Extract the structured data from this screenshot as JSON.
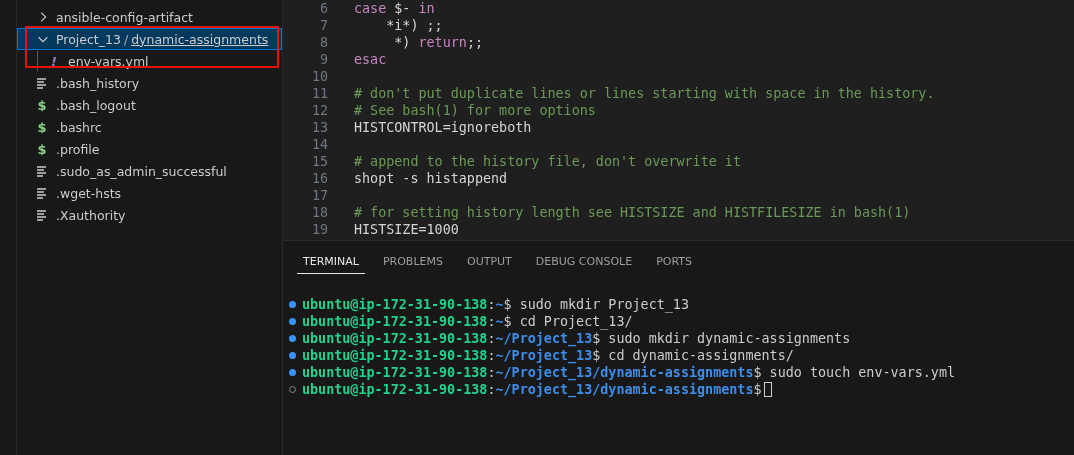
{
  "explorer": {
    "items": [
      {
        "kind": "folder",
        "label": "ansible-config-artifact",
        "expanded": false,
        "selected": false
      },
      {
        "kind": "folder",
        "label": "Project_13",
        "separator": "/",
        "sublabel": "dynamic-assignments",
        "expanded": true,
        "selected": true,
        "children": [
          {
            "kind": "yaml",
            "icon": "!",
            "label": "env-vars.yml",
            "selected": false
          }
        ]
      },
      {
        "kind": "text",
        "label": ".bash_history",
        "selected": false
      },
      {
        "kind": "shell",
        "icon": "$",
        "label": ".bash_logout",
        "selected": false
      },
      {
        "kind": "shell",
        "icon": "$",
        "label": ".bashrc",
        "selected": false
      },
      {
        "kind": "shell",
        "icon": "$",
        "label": ".profile",
        "selected": false
      },
      {
        "kind": "text",
        "label": ".sudo_as_admin_successful",
        "selected": false
      },
      {
        "kind": "text",
        "label": ".wget-hsts",
        "selected": false
      },
      {
        "kind": "text",
        "label": ".Xauthority",
        "selected": false
      }
    ]
  },
  "editor": {
    "lines": [
      {
        "number": "6",
        "tokens": [
          {
            "kind": "keyword",
            "text": "case"
          },
          {
            "kind": "plain",
            "text": " $- "
          },
          {
            "kind": "keyword",
            "text": "in"
          }
        ]
      },
      {
        "number": "7",
        "tokens": [
          {
            "kind": "plain",
            "text": "    *i*) ;;"
          }
        ]
      },
      {
        "number": "8",
        "tokens": [
          {
            "kind": "plain",
            "text": "     *) "
          },
          {
            "kind": "keyword",
            "text": "return"
          },
          {
            "kind": "plain",
            "text": ";;"
          }
        ]
      },
      {
        "number": "9",
        "tokens": [
          {
            "kind": "keyword",
            "text": "esac"
          }
        ]
      },
      {
        "number": "10"
      },
      {
        "number": "11",
        "tokens": [
          {
            "kind": "comment",
            "text": "# don't put duplicate lines or lines starting with space in the history."
          }
        ]
      },
      {
        "number": "12",
        "tokens": [
          {
            "kind": "comment",
            "text": "# See bash(1) for more options"
          }
        ]
      },
      {
        "number": "13",
        "tokens": [
          {
            "kind": "plain",
            "text": "HISTCONTROL=ignoreboth"
          }
        ]
      },
      {
        "number": "14"
      },
      {
        "number": "15",
        "tokens": [
          {
            "kind": "comment",
            "text": "# append to the history file, don't overwrite it"
          }
        ]
      },
      {
        "number": "16",
        "tokens": [
          {
            "kind": "plain",
            "text": "shopt -s histappend"
          }
        ]
      },
      {
        "number": "17"
      },
      {
        "number": "18",
        "tokens": [
          {
            "kind": "comment",
            "text": "# for setting history length see HISTSIZE and HISTFILESIZE in bash(1)"
          }
        ]
      },
      {
        "number": "19",
        "tokens": [
          {
            "kind": "plain",
            "text": "HISTSIZE=1000"
          }
        ]
      }
    ]
  },
  "panel": {
    "tabs": [
      {
        "label": "TERMINAL",
        "selected": true
      },
      {
        "label": "PROBLEMS",
        "selected": false
      },
      {
        "label": "OUTPUT",
        "selected": false
      },
      {
        "label": "DEBUG CONSOLE",
        "selected": false
      },
      {
        "label": "PORTS",
        "selected": false
      }
    ],
    "terminal": [
      {
        "kind": "done",
        "user": "ubuntu@ip-172-31-90-138",
        "separator": ":",
        "path": "~",
        "command": "$ sudo mkdir Project_13"
      },
      {
        "kind": "done",
        "user": "ubuntu@ip-172-31-90-138",
        "separator": ":",
        "path": "~",
        "command": "$ cd Project_13/"
      },
      {
        "kind": "done",
        "user": "ubuntu@ip-172-31-90-138",
        "separator": ":",
        "path": "~/Project_13",
        "command": "$ sudo mkdir dynamic-assignments"
      },
      {
        "kind": "done",
        "user": "ubuntu@ip-172-31-90-138",
        "separator": ":",
        "path": "~/Project_13",
        "command": "$ cd dynamic-assignments/"
      },
      {
        "kind": "done",
        "user": "ubuntu@ip-172-31-90-138",
        "separator": ":",
        "path": "~/Project_13/dynamic-assignments",
        "command": "$ sudo touch env-vars.yml"
      },
      {
        "kind": "current",
        "user": "ubuntu@ip-172-31-90-138",
        "separator": ":",
        "path": "~/Project_13/dynamic-assignments",
        "command": "$"
      }
    ]
  }
}
